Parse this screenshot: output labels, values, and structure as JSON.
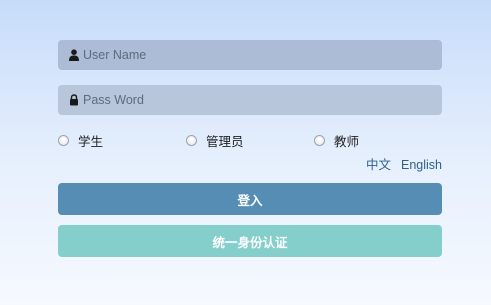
{
  "login": {
    "username_placeholder": "User Name",
    "password_placeholder": "Pass Word",
    "roles": [
      "学生",
      "管理员",
      "教师"
    ],
    "lang_zh": "中文",
    "lang_en": "English",
    "login_button": "登入",
    "sso_button": "统一身份认证"
  },
  "icons": {
    "username": "user-icon",
    "password": "lock-icon"
  },
  "colors": {
    "login_button": "#568db5",
    "sso_button": "#84cfcc",
    "link": "#2f5f8f",
    "field": "#b1c0d6"
  }
}
